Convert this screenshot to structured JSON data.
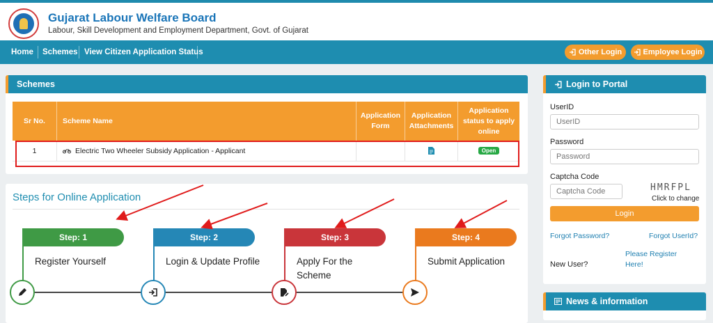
{
  "header": {
    "title": "Gujarat Labour Welfare Board",
    "subtitle": "Labour, Skill Development and Employment Department, Govt. of Gujarat"
  },
  "nav": {
    "items": [
      "Home",
      "Schemes",
      "View Citizen Application Status"
    ],
    "other_login": "Other Login",
    "employee_login": "Employee Login"
  },
  "schemes": {
    "heading": "Schemes",
    "columns": {
      "sr": "Sr No.",
      "name": "Scheme Name",
      "form": "Application Form",
      "attachments": "Application Attachments",
      "status": "Application status to apply online"
    },
    "rows": [
      {
        "sr": "1",
        "name": "Electric Two Wheeler Subsidy Application - Applicant",
        "status_badge": "Open"
      }
    ]
  },
  "steps": {
    "title": "Steps for Online Application",
    "items": [
      {
        "tab": "Step: 1",
        "text": "Register Yourself",
        "color": "#3f9a45",
        "icon": "pencil-icon"
      },
      {
        "tab": "Step: 2",
        "text": "Login & Update Profile",
        "color": "#2587b6",
        "icon": "login-icon"
      },
      {
        "tab": "Step: 3",
        "text": "Apply For the Scheme",
        "color": "#c9353a",
        "icon": "edit-document-icon"
      },
      {
        "tab": "Step: 4",
        "text": "Submit Application",
        "color": "#ea7a1e",
        "icon": "send-icon"
      }
    ]
  },
  "login": {
    "heading": "Login to Portal",
    "userid_label": "UserID",
    "userid_placeholder": "UserID",
    "password_label": "Password",
    "password_placeholder": "Password",
    "captcha_label": "Captcha Code",
    "captcha_placeholder": "Captcha Code",
    "captcha_text": "HMRFPL",
    "captcha_hint": "Click to change",
    "button": "Login",
    "forgot_password": "Forgot Password?",
    "forgot_userid": "Forgot UserId?",
    "new_user": "New User?",
    "register": "Please Register Here!"
  },
  "news": {
    "heading": "News & information"
  },
  "colors": {
    "primary": "#1e8db0",
    "accent": "#f39c2e",
    "highlight": "#e01b1b",
    "open_badge": "#27a844"
  }
}
